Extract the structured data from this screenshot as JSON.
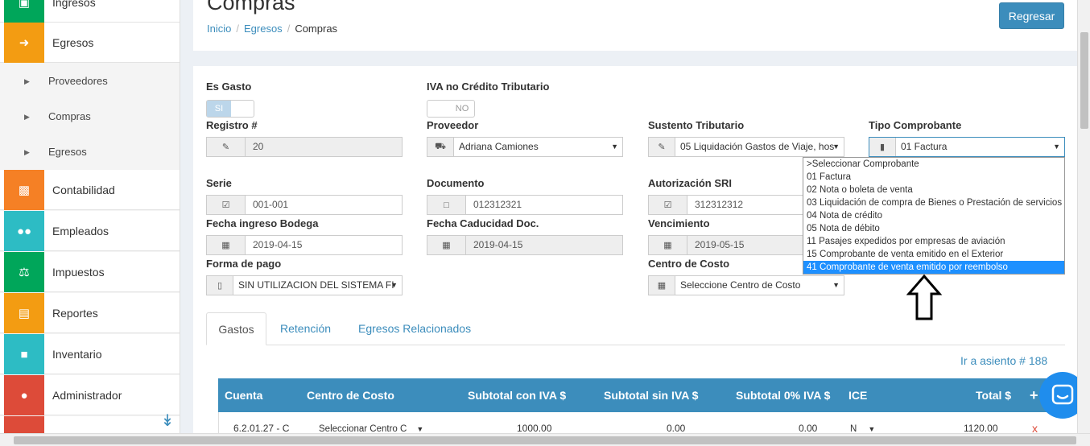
{
  "sidebar": {
    "items": [
      {
        "label": "Ingresos",
        "icon": "money-icon",
        "color": "#00a65a"
      },
      {
        "label": "Egresos",
        "icon": "sign-in-icon",
        "color": "#f39c12"
      },
      {
        "label": "Contabilidad",
        "icon": "briefcase-icon",
        "color": "#f58025"
      },
      {
        "label": "Empleados",
        "icon": "users-icon",
        "color": "#2dbcc4"
      },
      {
        "label": "Impuestos",
        "icon": "balance-scale-icon",
        "color": "#00a65a"
      },
      {
        "label": "Reportes",
        "icon": "bar-chart-icon",
        "color": "#f39c12"
      },
      {
        "label": "Inventario",
        "icon": "archive-icon",
        "color": "#2dbcc4"
      },
      {
        "label": "Administrador",
        "icon": "user-icon",
        "color": "#dd4b39"
      }
    ],
    "sub_items": [
      "Proveedores",
      "Compras",
      "Egresos"
    ]
  },
  "header": {
    "title": "Compras",
    "breadcrumb": [
      "Inicio",
      "Egresos",
      "Compras"
    ],
    "back_button": "Regresar"
  },
  "form": {
    "es_gasto": {
      "label": "Es Gasto",
      "value": "SI"
    },
    "iva": {
      "label": "IVA no Crédito Tributario",
      "value": "NO"
    },
    "registro": {
      "label": "Registro #",
      "value": "20"
    },
    "proveedor": {
      "label": "Proveedor",
      "value": "Adriana Camiones"
    },
    "sustento": {
      "label": "Sustento Tributario",
      "value": "05 Liquidación Gastos de Viaje, hos"
    },
    "tipo": {
      "label": "Tipo Comprobante",
      "value": "01 Factura"
    },
    "serie": {
      "label": "Serie",
      "value": "001-001"
    },
    "documento": {
      "label": "Documento",
      "value": "012312321"
    },
    "autorizacion": {
      "label": "Autorización SRI",
      "value": "312312312"
    },
    "fecha_bodega": {
      "label": "Fecha ingreso Bodega",
      "value": "2019-04-15"
    },
    "fecha_caducidad": {
      "label": "Fecha Caducidad Doc.",
      "value": "2019-04-15"
    },
    "vencimiento": {
      "label": "Vencimiento",
      "value": "2019-05-15"
    },
    "forma_pago": {
      "label": "Forma de pago",
      "value": "SIN UTILIZACION DEL SISTEMA FI"
    },
    "centro_costo": {
      "label": "Centro de Costo",
      "value": "Seleccione Centro de Costo"
    }
  },
  "tipo_options": [
    ">Seleccionar Comprobante",
    "01 Factura",
    "02 Nota o boleta de venta",
    "03 Liquidación de compra de Bienes o Prestación de servicios",
    "04 Nota de crédito",
    "05 Nota de débito",
    "11 Pasajes expedidos por empresas de aviación",
    "15 Comprobante de venta emitido en el Exterior",
    "41 Comprobante de venta emitido por reembolso"
  ],
  "tabs": [
    "Gastos",
    "Retención",
    "Egresos Relacionados"
  ],
  "asiento_link": "Ir a asiento # 188",
  "table": {
    "headers": [
      "Cuenta",
      "Centro de Costo",
      "Subtotal con IVA $",
      "Subtotal sin IVA $",
      "Subtotal 0% IVA $",
      "ICE",
      "Total $",
      "+"
    ],
    "row": {
      "cuenta": "6.2.01.27 - C",
      "centro": "Seleccionar Centro C",
      "con_iva": "1000.00",
      "sin_iva": "0.00",
      "cero_iva": "0.00",
      "ice": "N",
      "total": "1120.00",
      "delete": "x"
    }
  }
}
